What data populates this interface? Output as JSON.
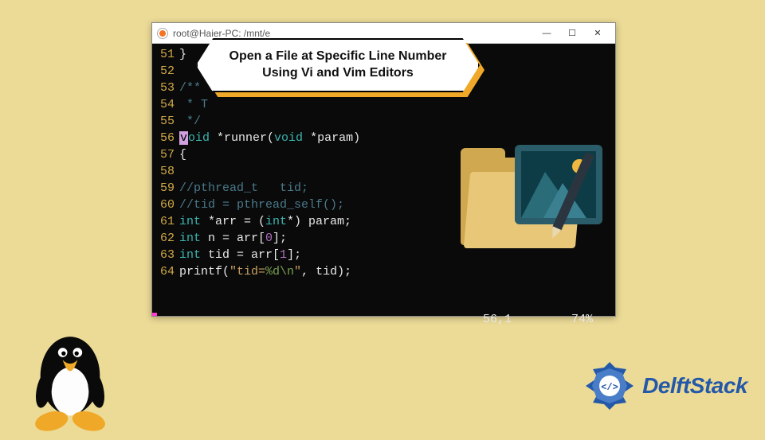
{
  "window": {
    "title": "root@Haier-PC: /mnt/e"
  },
  "banner": {
    "line1": "Open a File at Specific Line Number",
    "line2": "Using Vi and Vim Editors"
  },
  "status": {
    "position": "56,1",
    "percent": "74%"
  },
  "code": [
    {
      "num": "51",
      "seg": [
        {
          "c": "c-white",
          "t": "}"
        }
      ]
    },
    {
      "num": "52",
      "seg": []
    },
    {
      "num": "53",
      "seg": [
        {
          "c": "c-comment",
          "t": "/**"
        }
      ]
    },
    {
      "num": "54",
      "seg": [
        {
          "c": "c-comment",
          "t": " * T"
        }
      ]
    },
    {
      "num": "55",
      "seg": [
        {
          "c": "c-comment",
          "t": " */"
        }
      ]
    },
    {
      "num": "56",
      "seg": [
        {
          "c": "cursor",
          "t": "v"
        },
        {
          "c": "c-teal",
          "t": "oid"
        },
        {
          "c": "c-white",
          "t": " *runner("
        },
        {
          "c": "c-teal",
          "t": "void"
        },
        {
          "c": "c-white",
          "t": " *param)"
        }
      ]
    },
    {
      "num": "57",
      "seg": [
        {
          "c": "c-white",
          "t": "{"
        }
      ]
    },
    {
      "num": "58",
      "seg": []
    },
    {
      "num": "59",
      "seg": [
        {
          "c": "c-comment",
          "t": "//pthread_t   tid;"
        }
      ]
    },
    {
      "num": "60",
      "seg": [
        {
          "c": "c-comment",
          "t": "//tid = pthread_self();"
        }
      ]
    },
    {
      "num": "61",
      "seg": [
        {
          "c": "c-teal",
          "t": "int"
        },
        {
          "c": "c-white",
          "t": " *arr = ("
        },
        {
          "c": "c-teal",
          "t": "int"
        },
        {
          "c": "c-white",
          "t": "*) param;"
        }
      ]
    },
    {
      "num": "62",
      "seg": [
        {
          "c": "c-teal",
          "t": "int"
        },
        {
          "c": "c-white",
          "t": " n = arr["
        },
        {
          "c": "c-purple",
          "t": "0"
        },
        {
          "c": "c-white",
          "t": "];"
        }
      ]
    },
    {
      "num": "63",
      "seg": [
        {
          "c": "c-teal",
          "t": "int"
        },
        {
          "c": "c-white",
          "t": " tid = arr["
        },
        {
          "c": "c-purple",
          "t": "1"
        },
        {
          "c": "c-white",
          "t": "];"
        }
      ]
    },
    {
      "num": "64",
      "seg": [
        {
          "c": "c-white",
          "t": "printf("
        },
        {
          "c": "c-str",
          "t": "\"tid="
        },
        {
          "c": "c-green",
          "t": "%d\\n"
        },
        {
          "c": "c-str",
          "t": "\""
        },
        {
          "c": "c-white",
          "t": ", tid);"
        }
      ]
    }
  ],
  "brand": {
    "name": "DelftStack"
  }
}
